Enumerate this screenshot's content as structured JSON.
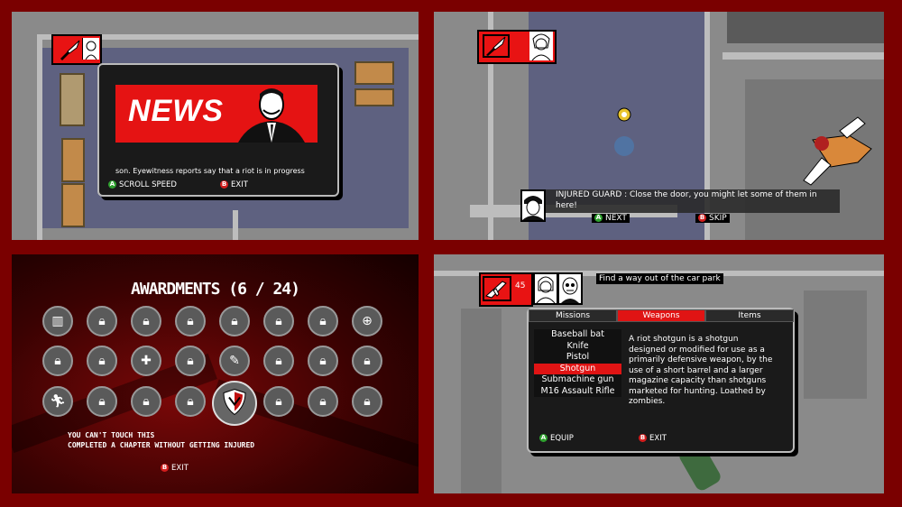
{
  "panel_news": {
    "headline": "NEWS",
    "ticker": "son. Eyewitness reports say that a riot is in progress",
    "btn_a_label": "A",
    "btn_a_action": "SCROLL SPEED",
    "btn_b_label": "B",
    "btn_b_action": "EXIT"
  },
  "panel_dialog": {
    "message": "INJURED GUARD : Close the door, you might let some of them in here!",
    "btn_a_label": "A",
    "btn_a_action": "NEXT",
    "btn_b_label": "B",
    "btn_b_action": "SKIP"
  },
  "panel_awards": {
    "title": "AWARDMENTS (6 / 24)",
    "selected_name": "YOU CAN'T TOUCH THIS",
    "selected_desc": "COMPLETED A CHAPTER WITHOUT GETTING INJURED",
    "btn_b_label": "B",
    "btn_b_action": "EXIT",
    "unlocked_count": 6,
    "total_count": 24
  },
  "panel_inventory": {
    "ammo": "45",
    "objective": "Find a way out of the car park",
    "tabs": [
      "Missions",
      "Weapons",
      "Items"
    ],
    "active_tab": "Weapons",
    "weapons": [
      "Baseball bat",
      "Knife",
      "Pistol",
      "Shotgun",
      "Submachine gun",
      "M16 Assault Rifle"
    ],
    "selected_weapon": "Shotgun",
    "description": "A riot shotgun is a shotgun designed or modified for use as a primarily defensive weapon, by the use of a short barrel and a larger magazine capacity than shotguns marketed for hunting. Loathed by zombies.",
    "btn_a_label": "A",
    "btn_a_action": "EQUIP",
    "btn_b_label": "B",
    "btn_b_action": "EXIT"
  },
  "colors": {
    "frame": "#7a0000",
    "accent_red": "#e81313",
    "button_a": "#2fa12f",
    "button_b": "#d21d1d"
  },
  "icons": [
    "knife-icon",
    "portrait-icon",
    "assault-rifle-icon",
    "zombie-icon",
    "lock-icon",
    "barricade-icon",
    "crosshair-icon",
    "medkit-icon",
    "syringe-icon",
    "running-man-icon",
    "shield-icon"
  ]
}
